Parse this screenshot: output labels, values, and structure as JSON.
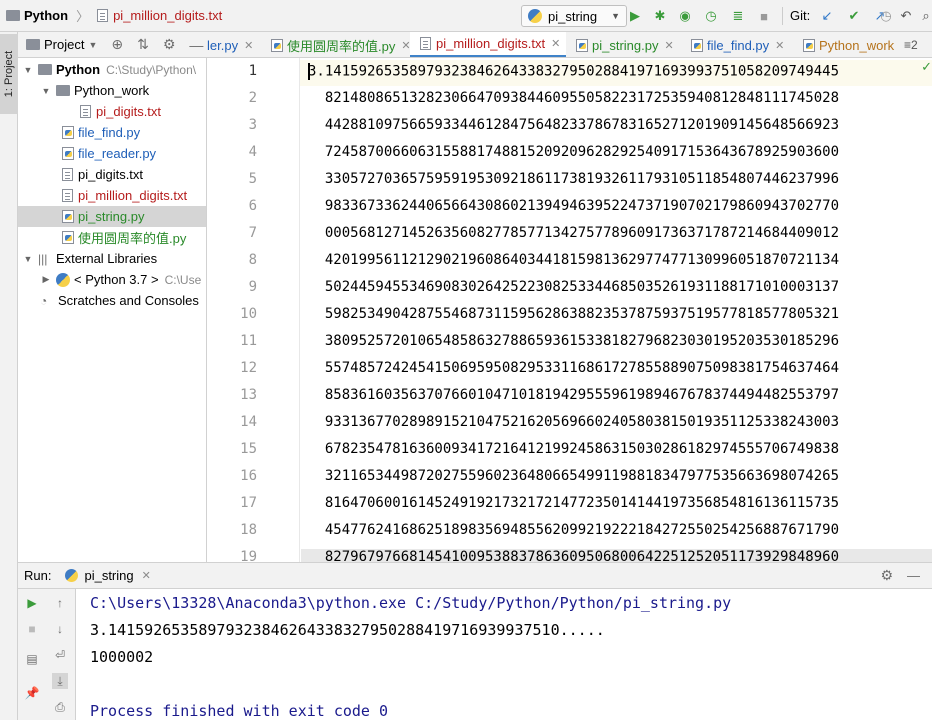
{
  "breadcrumb": {
    "project": "Python",
    "file": "pi_million_digits.txt"
  },
  "toolbar": {
    "run_config": "pi_string",
    "git_label": "Git:"
  },
  "sidebar": {
    "vertical_tab": "1: Project",
    "header_label": "Project",
    "tree": [
      {
        "label": "Python",
        "path": "C:\\Study\\Python\\",
        "kind": "folder",
        "bold": true
      },
      {
        "label": "Python_work",
        "kind": "folder"
      },
      {
        "label": "pi_digits.txt",
        "kind": "txt",
        "color": "#b51c1c"
      },
      {
        "label": "file_find.py",
        "kind": "py",
        "color": "#1f5fb8"
      },
      {
        "label": "file_reader.py",
        "kind": "py",
        "color": "#1f5fb8"
      },
      {
        "label": "pi_digits.txt",
        "kind": "txt",
        "color": "#000000"
      },
      {
        "label": "pi_million_digits.txt",
        "kind": "txt",
        "color": "#b51c1c"
      },
      {
        "label": "pi_string.py",
        "kind": "py",
        "color": "#2a8a2a"
      },
      {
        "label": "使用圆周率的值.py",
        "kind": "py",
        "color": "#2a8a2a"
      },
      {
        "label": "External Libraries",
        "kind": "lib"
      },
      {
        "label": "< Python 3.7 >",
        "path": "C:\\Use",
        "kind": "pylib"
      },
      {
        "label": "Scratches and Consoles",
        "kind": "scratch"
      }
    ]
  },
  "tabs": [
    {
      "label": "ler.py",
      "color": "#1f5fb8"
    },
    {
      "label": "使用圆周率的值.py",
      "color": "#2a8a2a"
    },
    {
      "label": "pi_million_digits.txt",
      "color": "#b51c1c"
    },
    {
      "label": "pi_string.py",
      "color": "#2a8a2a"
    },
    {
      "label": "file_find.py",
      "color": "#1f5fb8"
    },
    {
      "label": "Python_work",
      "color": "#b5731c"
    }
  ],
  "tabs_overflow": "≡2",
  "editor": {
    "line_numbers": [
      "1",
      "2",
      "3",
      "4",
      "5",
      "6",
      "7",
      "8",
      "9",
      "10",
      "11",
      "12",
      "13",
      "14",
      "15",
      "16",
      "17",
      "18",
      "19"
    ],
    "lines": [
      "3.1415926535897932384626433832795028841971693993751058209749445",
      "  8214808651328230664709384460955058223172535940812848111745028",
      "  4428810975665933446128475648233786783165271201909145648566923",
      "  7245870066063155881748815209209628292540917153643678925903600",
      "  3305727036575959195309218611738193261179310511854807446237996",
      "  9833673362440656643086021394946395224737190702179860943702770",
      "  0005681271452635608277857713427577896091736371787214684409012",
      "  4201995611212902196086403441815981362977477130996051870721134",
      "  5024459455346908302642522308253344685035261931188171010003137",
      "  5982534904287554687311595628638823537875937519577818577805321",
      "  3809525720106548586327886593615338182796823030195203530185296",
      "  5574857242454150695950829533116861727855889075098381754637464",
      "  8583616035637076601047101819429555961989467678374494482553797",
      "  9331367702898915210475216205696602405803815019351125338243003",
      "  6782354781636009341721641219924586315030286182974555706749838",
      "  3211653449872027559602364806654991198818347977535663698074265",
      "  8164706001614524919217321721477235014144197356854816136115735",
      "  4547762416862518983569485562099219222184272550254256887671790",
      "  8279679766814541009538837863609506800642251252051173929848960"
    ]
  },
  "run_panel": {
    "label": "Run:",
    "config": "pi_string",
    "output": [
      {
        "text": "C:\\Users\\13328\\Anaconda3\\python.exe C:/Study/Python/Python/pi_string.py",
        "style": "blue"
      },
      {
        "text": "3.14159265358979323846264338327950288419716939937510.....",
        "style": "normal"
      },
      {
        "text": "1000002",
        "style": "normal"
      },
      {
        "text": "",
        "style": "normal"
      },
      {
        "text": "Process finished with exit code 0",
        "style": "blue"
      }
    ]
  },
  "colors": {
    "accent": "#4083c9",
    "selection": "#d5d5d5",
    "current_line": "#fcfaed",
    "console_blue": "#1a1a8c"
  }
}
